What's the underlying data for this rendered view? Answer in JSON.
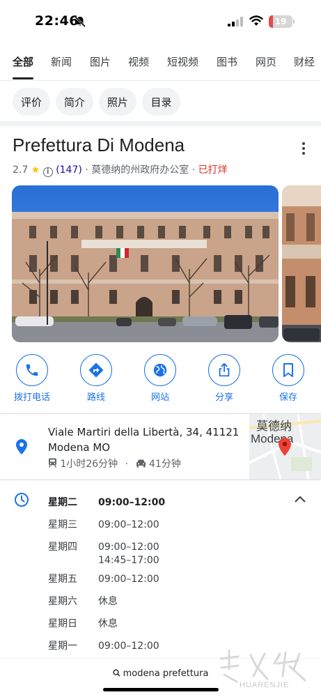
{
  "status_bar": {
    "time": "22:46",
    "battery_level": "19",
    "battery_fraction": 0.19,
    "battery_color": "#e34b4b"
  },
  "category_tabs": [
    "全部",
    "新闻",
    "图片",
    "视频",
    "短视频",
    "图书",
    "网页",
    "财经"
  ],
  "chips": [
    "评价",
    "简介",
    "照片",
    "目录"
  ],
  "place": {
    "name": "Prefettura Di Modena",
    "rating": "2.7",
    "star": "★",
    "reviews": "(147)",
    "category": "莫德纳的州政府办公室",
    "separator": "·",
    "status": "已打烊",
    "status_color": "#d93025"
  },
  "actions": {
    "call": "拨打电话",
    "directions": "路线",
    "website": "网站",
    "share": "分享",
    "save": "保存"
  },
  "address": {
    "line1": "Viale Martiri della Libertà, 34, 41121",
    "line2": "Modena MO",
    "transit_time": "1小时26分钟",
    "drive_time": "41分钟",
    "map_label_zh": "莫德纳",
    "map_label": "Modena"
  },
  "hours": [
    {
      "day": "星期二",
      "time": "09:00–12:00"
    },
    {
      "day": "星期三",
      "time": "09:00–12:00"
    },
    {
      "day": "星期四",
      "time": "09:00–12:00",
      "extra": "14:45–17:00"
    },
    {
      "day": "星期五",
      "time": "09:00–12:00"
    },
    {
      "day": "星期六",
      "time": "休息"
    },
    {
      "day": "星期日",
      "time": "休息"
    },
    {
      "day": "星期一",
      "time": "09:00–12:00"
    }
  ],
  "bottom": {
    "query": "modena prefettura",
    "watermark": "HUARENJIE"
  },
  "colors": {
    "accent": "#1a73e8",
    "star": "#fbbc04",
    "link": "#1a0dab"
  }
}
